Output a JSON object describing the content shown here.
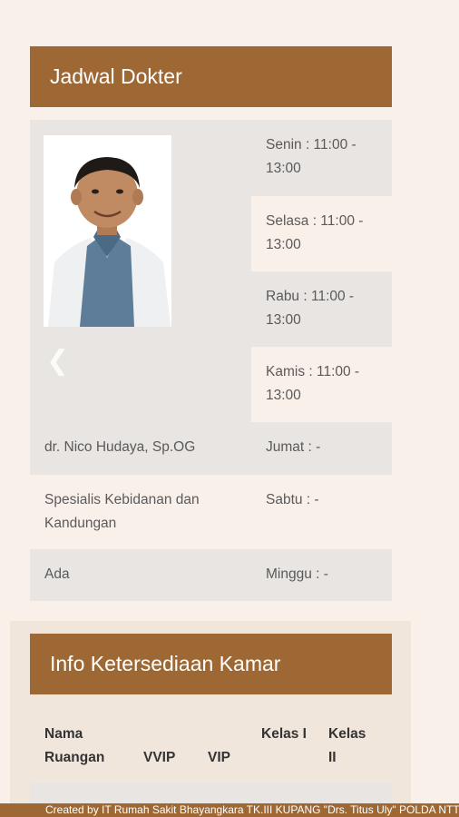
{
  "doctor_schedule": {
    "title": "Jadwal Dokter",
    "doctor": {
      "name": "dr. Nico Hudaya, Sp.OG",
      "specialty": "Spesialis Kebidanan dan Kandungan",
      "status": "Ada"
    },
    "schedule": [
      {
        "text": "Senin : 11:00 - 13:00"
      },
      {
        "text": "Selasa : 11:00 - 13:00"
      },
      {
        "text": "Rabu : 11:00 - 13:00"
      },
      {
        "text": "Kamis : 11:00 - 13:00"
      },
      {
        "text": "Jumat : -"
      },
      {
        "text": "Sabtu : -"
      },
      {
        "text": "Minggu : -"
      }
    ],
    "nav": {
      "prev_icon": "chevron-left-icon",
      "next_icon": "chevron-right-icon"
    }
  },
  "room_info": {
    "title": "Info Ketersediaan Kamar",
    "columns": {
      "name": "Nama Ruangan",
      "vvip": "VVIP",
      "vip": "VIP",
      "kelas1": "Kelas I",
      "kelas2": "Kelas II"
    }
  },
  "footer": {
    "text": "Created by IT Rumah Sakit Bhayangkara TK.III KUPANG \"Drs. Titus Uly\" POLDA NTT"
  },
  "colors": {
    "accent": "#9e6834",
    "page_bg": "#faf0ea",
    "cell_grey": "#e8e5e2"
  }
}
